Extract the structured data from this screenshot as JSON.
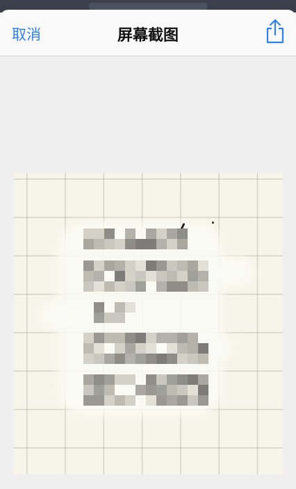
{
  "nav": {
    "cancel_label": "取消",
    "title": "屏幕截图",
    "share_icon": "share-icon"
  },
  "colors": {
    "accent": "#2f80e8",
    "paper": "#f6f5e9",
    "sheet": "#f9f9f9",
    "background": "#efefef"
  },
  "preview": {
    "content": "pixelated-redacted-handwriting"
  }
}
